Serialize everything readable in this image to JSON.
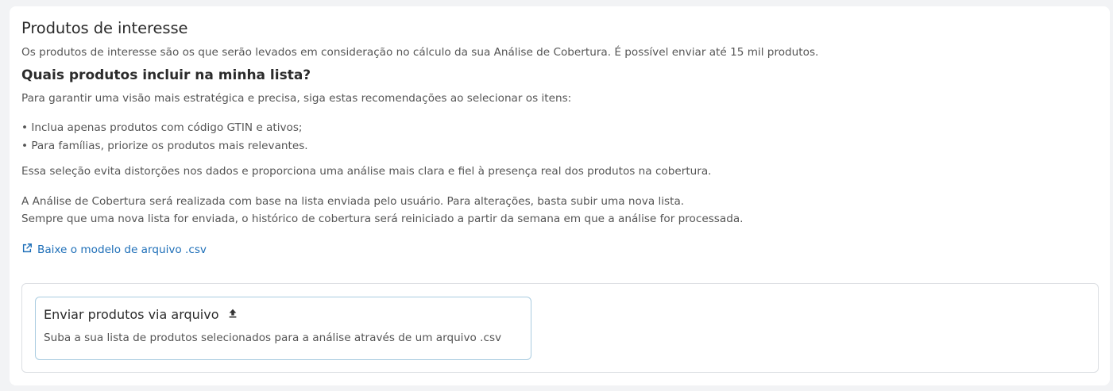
{
  "section": {
    "title": "Produtos de interesse",
    "description": "Os produtos de interesse são os que serão levados em consideração no cálculo da sua Análise de Cobertura. É possível enviar até 15 mil produtos.",
    "subtitle": "Quais produtos incluir na minha lista?",
    "intro": "Para garantir uma visão mais estratégica e precisa, siga estas recomendações ao selecionar os itens:",
    "bullets": [
      "• Inclua apenas produtos com código GTIN e ativos;",
      "• Para famílias, priorize os produtos mais relevantes."
    ],
    "note": "Essa seleção evita distorções nos dados e proporciona uma análise mais clara e fiel à presença real dos produtos na cobertura.",
    "info_line1": "A Análise de Cobertura será realizada com base na lista enviada pelo usuário. Para alterações, basta subir uma nova lista.",
    "info_line2": "Sempre que uma nova lista for enviada, o histórico de cobertura será reiniciado a partir da semana em que a análise for processada.",
    "download_link": "Baixe o modelo de arquivo .csv"
  },
  "upload": {
    "title": "Enviar produtos via arquivo",
    "description": "Suba a sua lista de produtos selecionados para a análise através de um arquivo .csv"
  },
  "icons": {
    "link": "external-link-icon",
    "upload": "upload-icon"
  },
  "colors": {
    "link": "#1e6fb8",
    "card_border": "#a9cce0"
  }
}
